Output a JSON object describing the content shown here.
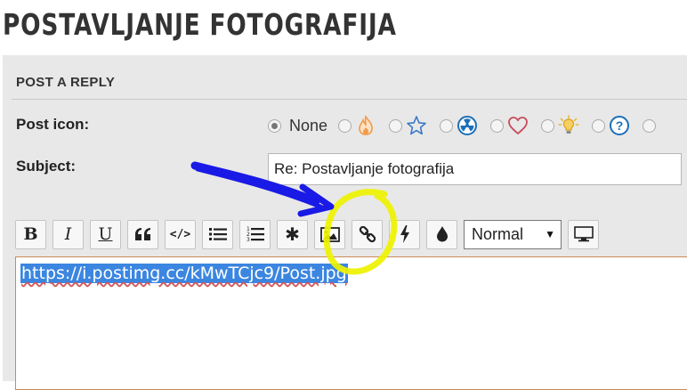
{
  "page": {
    "title": "POSTAVLJANJE FOTOGRAFIJA"
  },
  "form": {
    "section_header": "POST A REPLY",
    "post_icon": {
      "label": "Post icon:",
      "options": [
        {
          "label": "None",
          "icon": "none",
          "selected": true
        },
        {
          "label": "",
          "icon": "fire-icon",
          "color": "#f29a4a"
        },
        {
          "label": "",
          "icon": "star-icon",
          "color": "#3c78c8"
        },
        {
          "label": "",
          "icon": "radiation-icon",
          "color": "#1d6fb8"
        },
        {
          "label": "",
          "icon": "heart-icon",
          "color": "#c84a5a"
        },
        {
          "label": "",
          "icon": "lightbulb-icon",
          "color": "#e8b838"
        },
        {
          "label": "",
          "icon": "question-icon",
          "color": "#1d6fb8"
        }
      ]
    },
    "subject": {
      "label": "Subject:",
      "value": "Re: Postavljanje fotografija"
    }
  },
  "toolbar": {
    "buttons": [
      {
        "name": "bold-button",
        "glyph": "B"
      },
      {
        "name": "italic-button",
        "glyph": "I"
      },
      {
        "name": "underline-button",
        "glyph": "U"
      },
      {
        "name": "quote-button",
        "icon": "quote-icon"
      },
      {
        "name": "code-button",
        "glyph": "</>"
      },
      {
        "name": "list-button",
        "icon": "list-icon"
      },
      {
        "name": "numbered-list-button",
        "icon": "numbered-list-icon"
      },
      {
        "name": "list-item-button",
        "glyph": "✱"
      },
      {
        "name": "image-button",
        "icon": "image-icon"
      },
      {
        "name": "link-button",
        "icon": "link-icon"
      },
      {
        "name": "flash-button",
        "icon": "bolt-icon"
      },
      {
        "name": "color-button",
        "icon": "droplet-icon"
      }
    ],
    "font_size": {
      "value": "Normal"
    },
    "preview_icon": "monitor-icon"
  },
  "editor": {
    "content": "https://i.postimg.cc/kMwTCjc9/Post.jpg"
  },
  "annotations": {
    "arrow_color": "#1a1ae6",
    "highlight_color": "#eef200"
  }
}
